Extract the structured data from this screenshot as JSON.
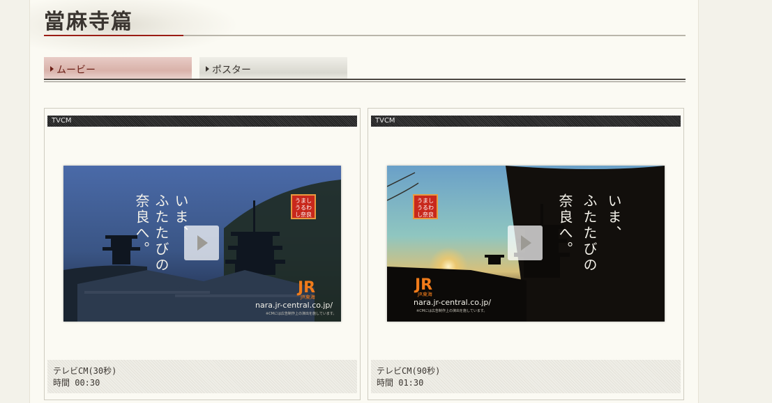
{
  "page": {
    "title": "當麻寺篇"
  },
  "tabs": [
    {
      "label": "ムービー"
    },
    {
      "label": "ポスター"
    }
  ],
  "videos": [
    {
      "tag": "TVCM",
      "caption_title": "テレビCM(30秒)",
      "caption_time": "時間 00:30",
      "copy_line1": "いま、",
      "copy_line2": "ふたたびの",
      "copy_line3": "奈良へ。",
      "badge": "うましうるわし奈良",
      "badge_lines": [
        "うまし",
        "うるわ",
        "し奈良"
      ],
      "brand_small": "JR東海",
      "url": "nara.jr-central.co.jp/",
      "disclaimer": "※CMには広告制作上の演出を施しています。"
    },
    {
      "tag": "TVCM",
      "caption_title": "テレビCM(90秒)",
      "caption_time": "時間 01:30",
      "copy_line1": "いま、",
      "copy_line2": "ふたたびの",
      "copy_line3": "奈良へ。",
      "badge": "うましうるわし奈良",
      "badge_lines": [
        "うまし",
        "うるわ",
        "し奈良"
      ],
      "brand_small": "JR東海",
      "url": "nara.jr-central.co.jp/",
      "disclaimer": "※CMには広告制作上の演出を施しています。"
    }
  ],
  "icons": {
    "play": "play-icon",
    "jr_logo": "jr-logo-icon"
  },
  "colors": {
    "accent_red": "#9a1c14",
    "jr_orange": "#f07b1a",
    "badge_red": "#c8281c"
  }
}
